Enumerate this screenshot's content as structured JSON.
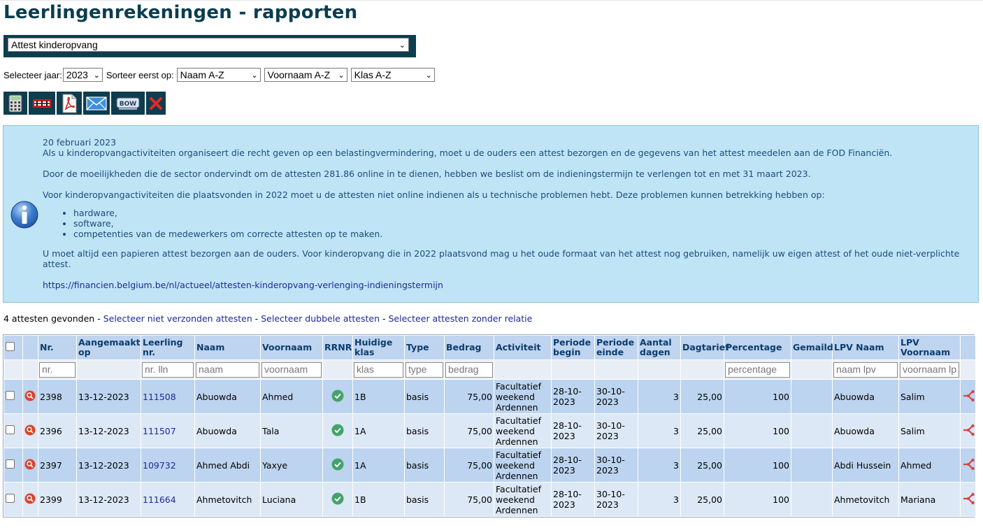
{
  "page": {
    "title": "Leerlingenrekeningen - rapporten"
  },
  "report_select": {
    "value": "Attest kinderopvang"
  },
  "filters": {
    "year_label": "Selecteer jaar:",
    "year_value": "2023",
    "sort_label": "Sorteer eerst op:",
    "sort1": "Naam A-Z",
    "sort2": "Voornaam A-Z",
    "sort3": "Klas A-Z"
  },
  "toolbar": {
    "buttons": [
      {
        "icon": "calculator-icon"
      },
      {
        "icon": "transfer-icon"
      },
      {
        "icon": "pdf-icon"
      },
      {
        "icon": "mail-icon"
      },
      {
        "icon": "bow-icon"
      },
      {
        "icon": "delete-icon"
      }
    ]
  },
  "info": {
    "date": "20 februari 2023",
    "p1": "Als u kinderopvangactiviteiten organiseert die recht geven op een belastingvermindering, moet u de ouders een attest bezorgen en de gegevens van het attest meedelen aan de FOD Financiën.",
    "p2": "Door de moeilijkheden die de sector ondervindt om de attesten 281.86 online in te dienen, hebben we beslist om de indieningstermijn te verlengen tot en met 31 maart 2023.",
    "p3": "Voor kinderopvangactiviteiten die plaatsvonden in 2022 moet u de attesten niet online indienen als u technische problemen hebt. Deze problemen kunnen betrekking hebben op:",
    "bullets": [
      "hardware,",
      "software,",
      "competenties van de medewerkers om correcte attesten op te maken."
    ],
    "p4_line1": "U moet altijd een papieren attest bezorgen aan de ouders. Voor kinderopvang die in 2022 plaatsvond mag u het oude formaat van het attest nog gebruiken, namelijk uw eigen attest of het oude niet-verplichte",
    "p4_line2": "attest.",
    "link": "https://financien.belgium.be/nl/actueel/attesten-kinderopvang-verlenging-indieningstermijn"
  },
  "found": {
    "count_text": "4 attesten gevonden",
    "sep": " - ",
    "link1": "Selecteer niet verzonden attesten",
    "link2": "Selecteer dubbele attesten",
    "link3": "Selecteer attesten zonder relatie"
  },
  "table": {
    "headers": {
      "nr": "Nr.",
      "aangemaakt_1": "Aangemaakt",
      "aangemaakt_2": "op",
      "leerling_1": "Leerling",
      "leerling_2": "nr.",
      "naam": "Naam",
      "voornaam": "Voornaam",
      "rrnr": "RRNR",
      "klas_1": "Huidige",
      "klas_2": "klas",
      "type": "Type",
      "bedrag": "Bedrag",
      "activiteit": "Activiteit",
      "pb_1": "Periode",
      "pb_2": "begin",
      "pe_1": "Periode",
      "pe_2": "einde",
      "ad_1": "Aantal",
      "ad_2": "dagen",
      "dagtarief": "Dagtarief",
      "percentage": "Percentage",
      "gemaild": "Gemaild",
      "lpv_naam": "LPV Naam",
      "lpv_vn_1": "LPV",
      "lpv_vn_2": "Voornaam"
    },
    "filter_placeholders": {
      "nr": "nr.",
      "lln": "nr. lln",
      "naam": "naam",
      "voornaam": "voornaam",
      "klas": "klas",
      "type": "type",
      "bedrag": "bedrag",
      "percentage": "percentage",
      "lpv_naam": "naam lpv",
      "lpv_voornaam": "voornaam lp"
    },
    "rows": [
      {
        "nr": "2398",
        "created": "13-12-2023",
        "lln": "111508",
        "naam": "Abuowda",
        "voornaam": "Ahmed",
        "klas": "1B",
        "type": "basis",
        "bedrag": "75,00",
        "act1": "Facultatief",
        "act2": "weekend",
        "act3": "Ardennen",
        "pb1": "28-10-",
        "pb2": "2023",
        "pe1": "30-10-",
        "pe2": "2023",
        "dagen": "3",
        "dagtarief": "25,00",
        "pct": "100",
        "lpv_naam": "Abuowda",
        "lpv_voornaam": "Salim"
      },
      {
        "nr": "2396",
        "created": "13-12-2023",
        "lln": "111507",
        "naam": "Abuowda",
        "voornaam": "Tala",
        "klas": "1A",
        "type": "basis",
        "bedrag": "75,00",
        "act1": "Facultatief",
        "act2": "weekend",
        "act3": "Ardennen",
        "pb1": "28-10-",
        "pb2": "2023",
        "pe1": "30-10-",
        "pe2": "2023",
        "dagen": "3",
        "dagtarief": "25,00",
        "pct": "100",
        "lpv_naam": "Abuowda",
        "lpv_voornaam": "Salim"
      },
      {
        "nr": "2397",
        "created": "13-12-2023",
        "lln": "109732",
        "naam": "Ahmed Abdi",
        "voornaam": "Yaxye",
        "klas": "1A",
        "type": "basis",
        "bedrag": "75,00",
        "act1": "Facultatief",
        "act2": "weekend",
        "act3": "Ardennen",
        "pb1": "28-10-",
        "pb2": "2023",
        "pe1": "30-10-",
        "pe2": "2023",
        "dagen": "3",
        "dagtarief": "25,00",
        "pct": "100",
        "lpv_naam": "Abdi Hussein",
        "lpv_voornaam": "Ahmed"
      },
      {
        "nr": "2399",
        "created": "13-12-2023",
        "lln": "111664",
        "naam": "Ahmetovitch",
        "voornaam": "Luciana",
        "klas": "1B",
        "type": "basis",
        "bedrag": "75,00",
        "act1": "Facultatief",
        "act2": "weekend",
        "act3": "Ardennen",
        "pb1": "28-10-",
        "pb2": "2023",
        "pe1": "30-10-",
        "pe2": "2023",
        "dagen": "3",
        "dagtarief": "25,00",
        "pct": "100",
        "lpv_naam": "Ahmetovitch",
        "lpv_voornaam": "Mariana"
      }
    ]
  }
}
